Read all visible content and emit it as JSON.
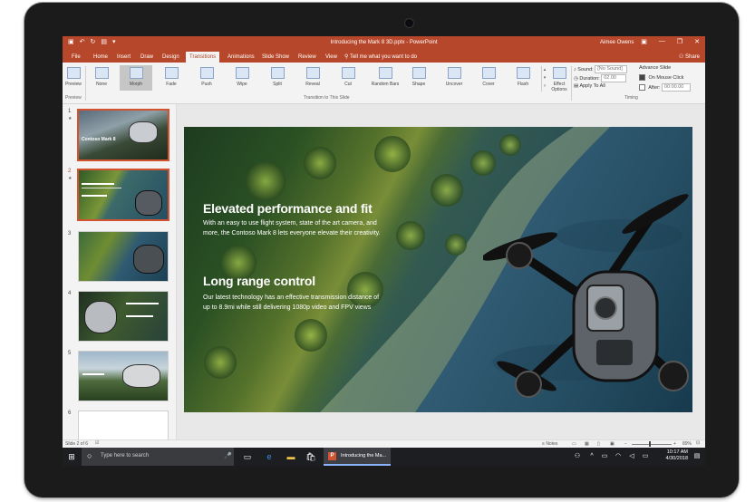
{
  "titlebar": {
    "document": "Introducing the Mark 8 3D.pptx  -  PowerPoint",
    "user": "Aimee Owens"
  },
  "tabs": [
    "File",
    "Home",
    "Insert",
    "Draw",
    "Design",
    "Transitions",
    "Animations",
    "Slide Show",
    "Review",
    "View"
  ],
  "active_tab": "Transitions",
  "tell_me": "Tell me what you want to do",
  "share": "Share",
  "ribbon": {
    "preview_label": "Preview",
    "preview_group": "Preview",
    "transitions": [
      "None",
      "Morph",
      "Fade",
      "Push",
      "Wipe",
      "Split",
      "Reveal",
      "Cut",
      "Random Bars",
      "Shape",
      "Uncover",
      "Cover",
      "Flash"
    ],
    "selected_transition": "Morph",
    "transitions_group": "Transition to This Slide",
    "effect_options_1": "Effect",
    "effect_options_2": "Options",
    "sound_label": "Sound:",
    "sound_value": "[No Sound]",
    "duration_label": "Duration:",
    "duration_value": "02.00",
    "apply_all": "Apply To All",
    "advance_label": "Advance Slide",
    "on_mouse_click": "On Mouse Click",
    "after_label": "After:",
    "after_value": "00:00.00",
    "timing_group": "Timing"
  },
  "thumbs": [
    "1",
    "2",
    "3",
    "4",
    "5",
    "6"
  ],
  "thumb1_title": "Contoso Mark 8",
  "slide": {
    "heading1": "Elevated performance and fit",
    "body1_line1": "With an easy to use flight system, state of the art camera, and",
    "body1_line2": "more, the Contoso Mark 8 lets everyone elevate their creativity.",
    "heading2": "Long range control",
    "body2_line1": "Our latest technology has an effective transmission distance of",
    "body2_line2": "up to 8.9mi while still delivering 1080p video and FPV views"
  },
  "status": {
    "slide_of": "Slide 2 of 6",
    "notes": "Notes",
    "zoom": "89%"
  },
  "taskbar": {
    "search_placeholder": "Type here to search",
    "ppt_task": "Introducing the Ma...",
    "time": "10:17 AM",
    "date": "4/30/2018"
  },
  "colors": {
    "accent": "#b7472a",
    "selected_border": "#d35230"
  }
}
